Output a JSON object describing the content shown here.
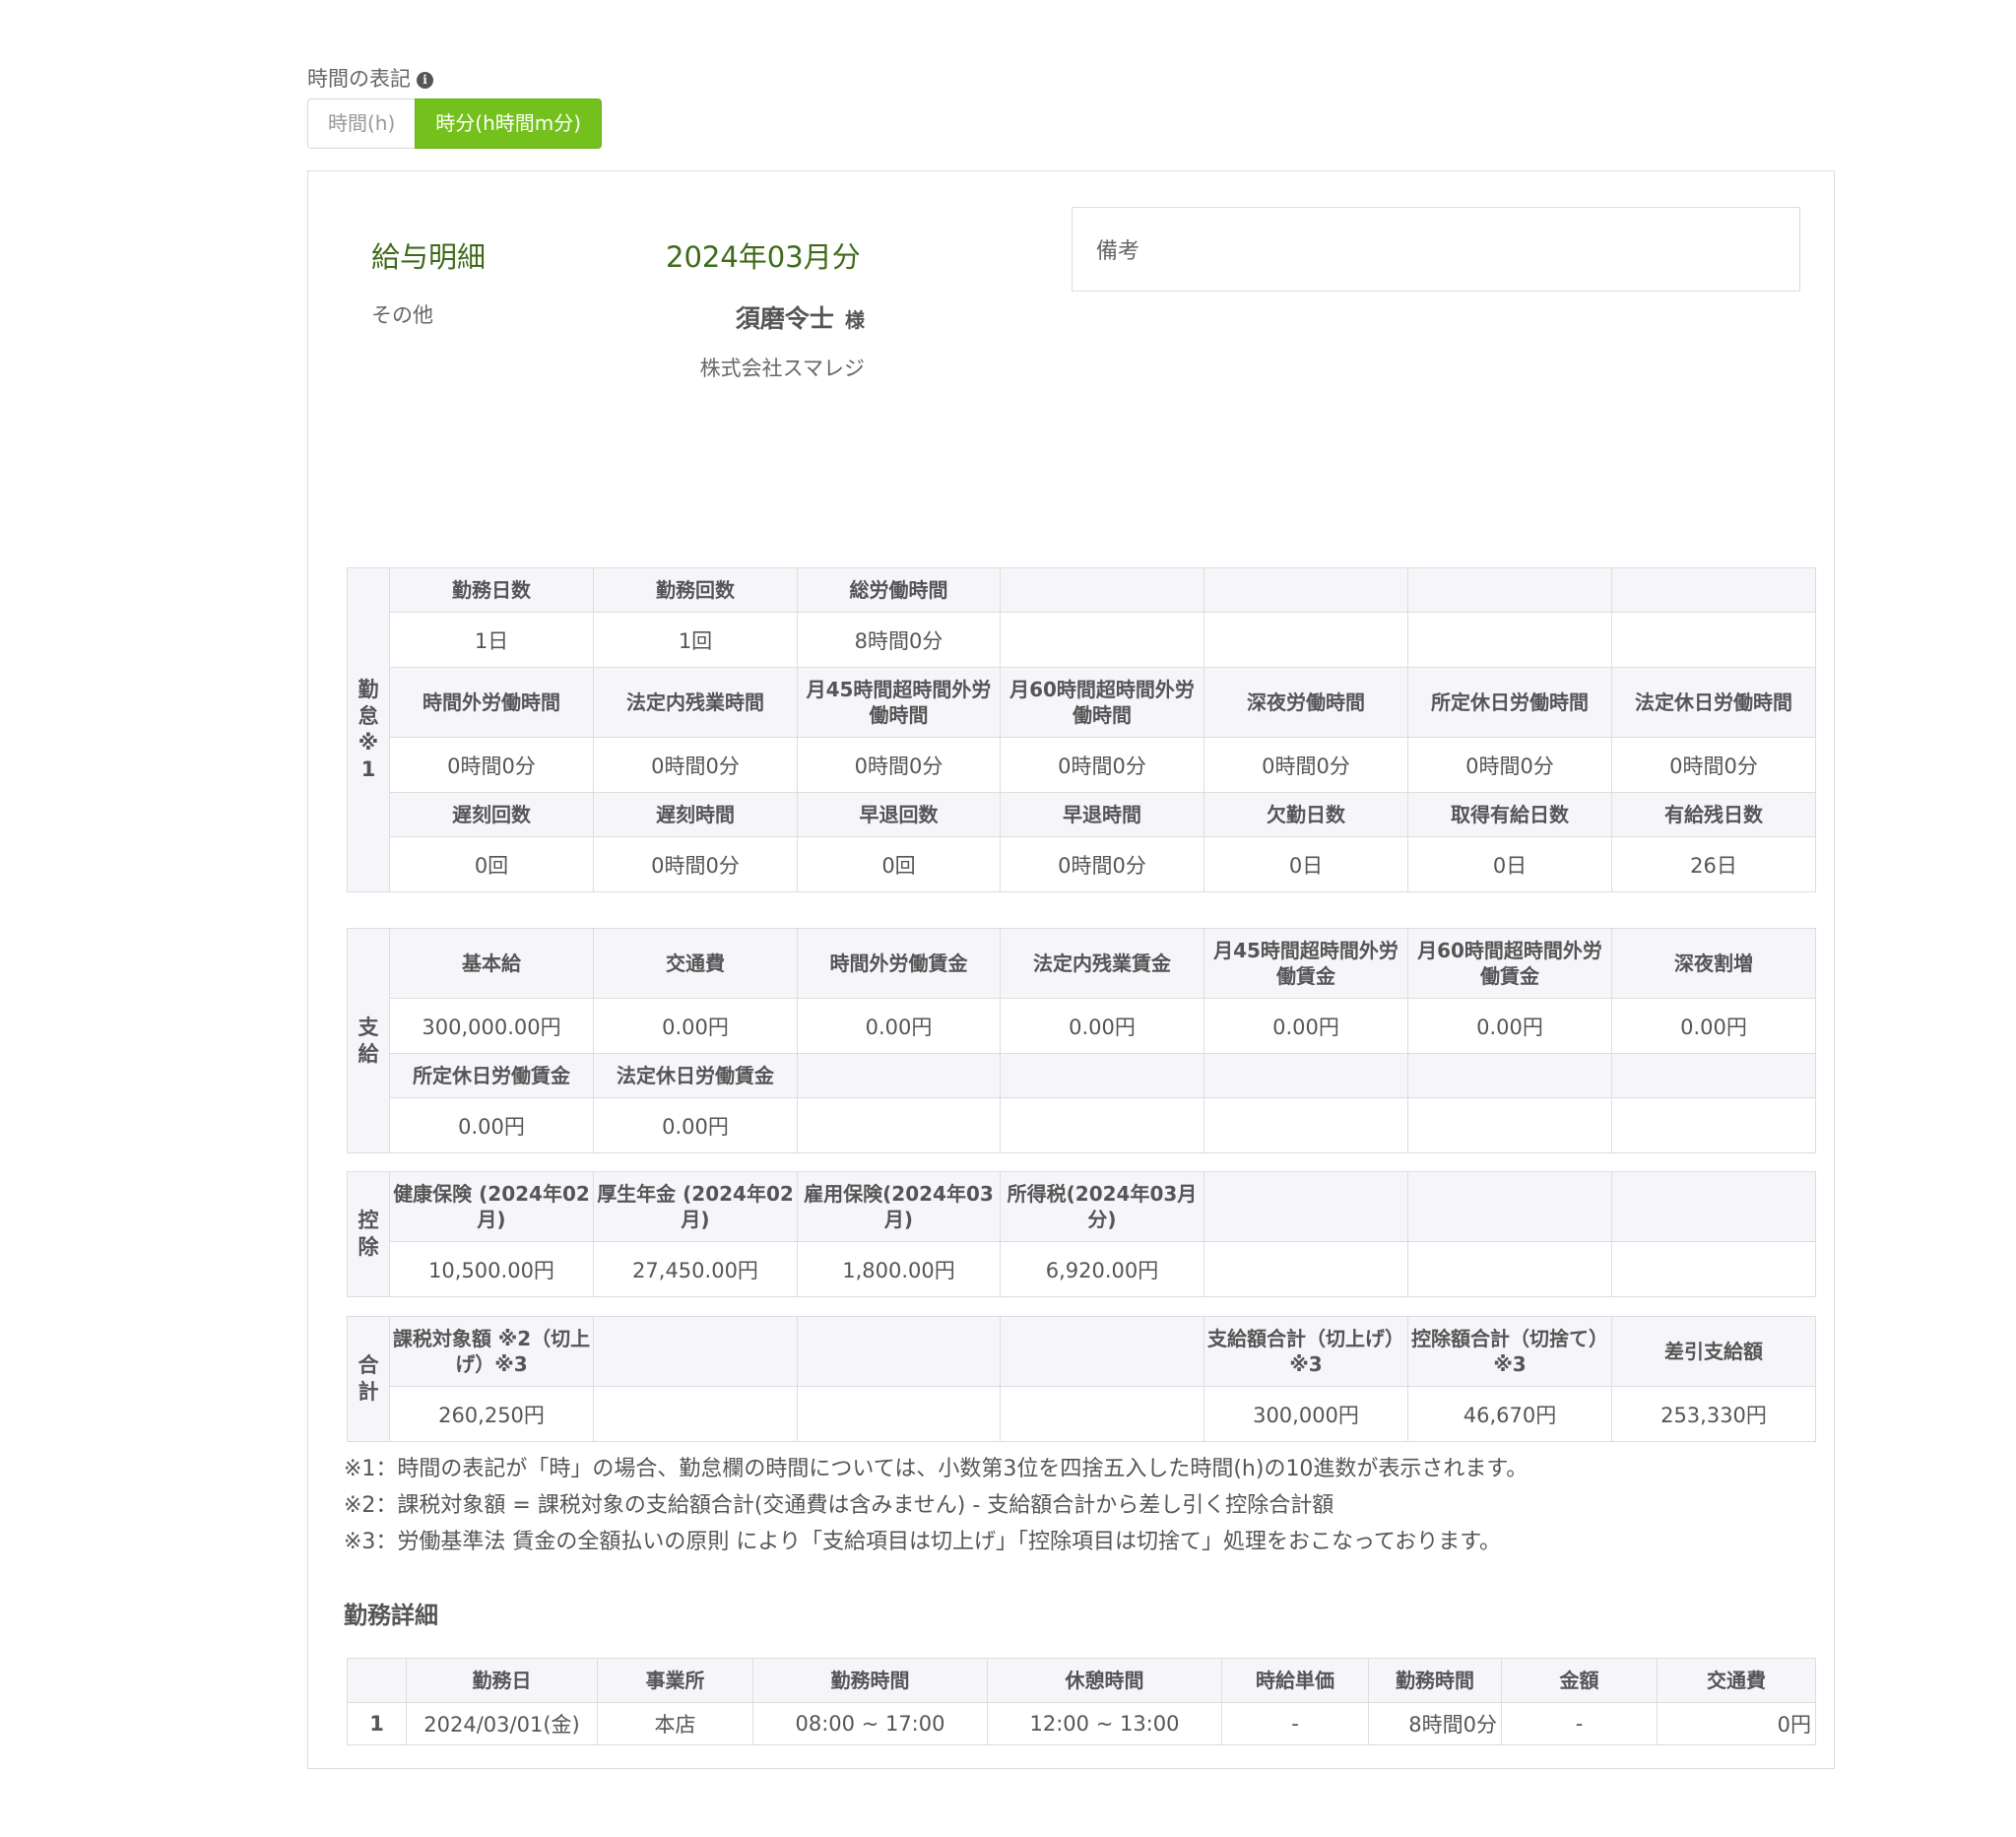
{
  "format_label": "時間の表記",
  "toggle": {
    "hours": "時間(h)",
    "hm": "時分(h時間m分)"
  },
  "slip": {
    "title": "給与明細",
    "period": "2024年03月分",
    "category": "その他",
    "employee": "須磨令士",
    "honorific": "様",
    "company": "株式会社スマレジ",
    "remarks_label": "備考"
  },
  "attendance": {
    "side": "勤怠※1",
    "row1_headers": [
      "勤務日数",
      "勤務回数",
      "総労働時間",
      "",
      "",
      "",
      ""
    ],
    "row1_values": [
      "1日",
      "1回",
      "8時間0分",
      "",
      "",
      "",
      ""
    ],
    "row2_headers": [
      "時間外労働時間",
      "法定内残業時間",
      "月45時間超時間外労働時間",
      "月60時間超時間外労働時間",
      "深夜労働時間",
      "所定休日労働時間",
      "法定休日労働時間"
    ],
    "row2_values": [
      "0時間0分",
      "0時間0分",
      "0時間0分",
      "0時間0分",
      "0時間0分",
      "0時間0分",
      "0時間0分"
    ],
    "row3_headers": [
      "遅刻回数",
      "遅刻時間",
      "早退回数",
      "早退時間",
      "欠勤日数",
      "取得有給日数",
      "有給残日数"
    ],
    "row3_values": [
      "0回",
      "0時間0分",
      "0回",
      "0時間0分",
      "0日",
      "0日",
      "26日"
    ]
  },
  "payment": {
    "side": "支給",
    "row1_headers": [
      "基本給",
      "交通費",
      "時間外労働賃金",
      "法定内残業賃金",
      "月45時間超時間外労働賃金",
      "月60時間超時間外労働賃金",
      "深夜割増"
    ],
    "row1_values": [
      "300,000.00円",
      "0.00円",
      "0.00円",
      "0.00円",
      "0.00円",
      "0.00円",
      "0.00円"
    ],
    "row2_headers": [
      "所定休日労働賃金",
      "法定休日労働賃金",
      "",
      "",
      "",
      "",
      ""
    ],
    "row2_values": [
      "0.00円",
      "0.00円",
      "",
      "",
      "",
      "",
      ""
    ]
  },
  "deduction": {
    "side": "控除",
    "headers": [
      "健康保険 (2024年02月)",
      "厚生年金 (2024年02月)",
      "雇用保険(2024年03月)",
      "所得税(2024年03月分)",
      "",
      "",
      ""
    ],
    "values": [
      "10,500.00円",
      "27,450.00円",
      "1,800.00円",
      "6,920.00円",
      "",
      "",
      ""
    ]
  },
  "total": {
    "side": "合計",
    "headers": [
      "課税対象額 ※2（切上げ）※3",
      "",
      "",
      "",
      "支給額合計（切上げ）※3",
      "控除額合計（切捨て）※3",
      "差引支給額"
    ],
    "values": [
      "260,250円",
      "",
      "",
      "",
      "300,000円",
      "46,670円",
      "253,330円"
    ]
  },
  "notes": [
    "※1：時間の表記が「時」の場合、勤怠欄の時間については、小数第3位を四捨五入した時間(h)の10進数が表示されます。",
    "※2：課税対象額 = 課税対象の支給額合計(交通費は含みません) - 支給額合計から差し引く控除合計額",
    "※3：労働基準法 賃金の全額払いの原則 により「支給項目は切上げ」「控除項目は切捨て」処理をおこなっております。"
  ],
  "work_detail": {
    "title": "勤務詳細",
    "headers": [
      "",
      "勤務日",
      "事業所",
      "勤務時間",
      "休憩時間",
      "時給単価",
      "勤務時間",
      "金額",
      "交通費"
    ],
    "rows": [
      [
        "1",
        "2024/03/01(金)",
        "本店",
        "08:00 ~ 17:00",
        "12:00 ~ 13:00",
        "-",
        "8時間0分",
        "-",
        "0円"
      ]
    ]
  }
}
